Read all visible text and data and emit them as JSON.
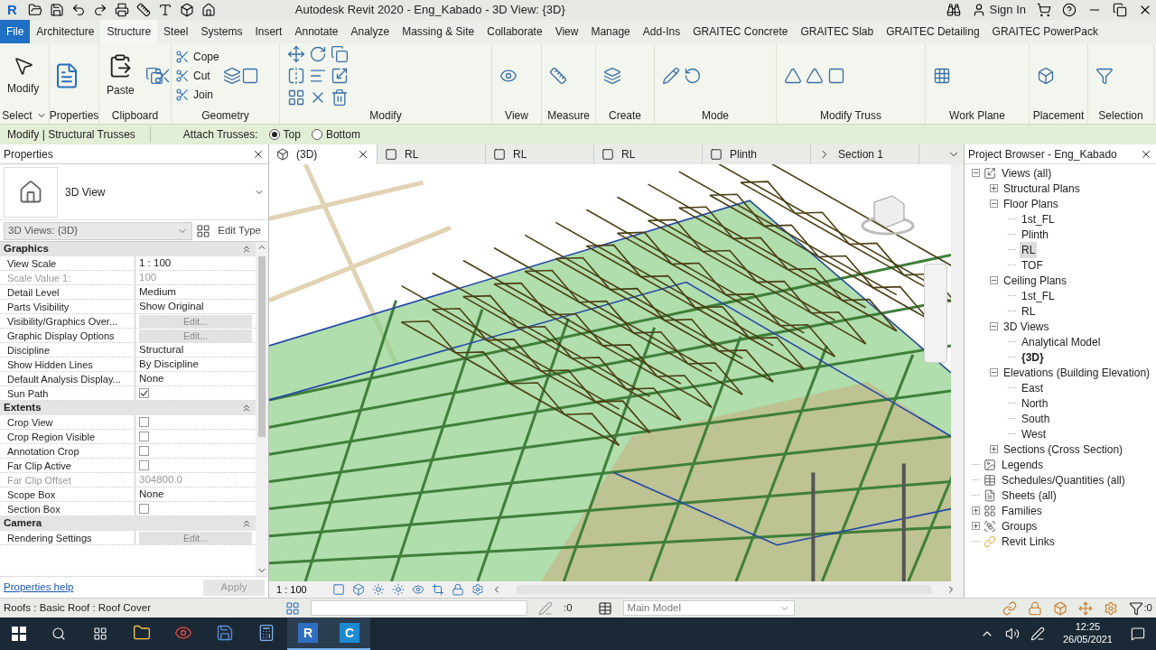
{
  "title_bar": {
    "logo": "R",
    "title": "Autodesk Revit 2020 - Eng_Kabado - 3D View: {3D}",
    "sign_in": "Sign In"
  },
  "menu_tabs": [
    {
      "label": "File",
      "kind": "file",
      "selected": false
    },
    {
      "label": "Architecture",
      "kind": "tab",
      "selected": false
    },
    {
      "label": "Structure",
      "kind": "tab",
      "selected": true
    },
    {
      "label": "Steel",
      "kind": "tab",
      "selected": false
    },
    {
      "label": "Systems",
      "kind": "tab",
      "selected": false
    },
    {
      "label": "Insert",
      "kind": "tab",
      "selected": false
    },
    {
      "label": "Annotate",
      "kind": "tab",
      "selected": false
    },
    {
      "label": "Analyze",
      "kind": "tab",
      "selected": false
    },
    {
      "label": "Massing & Site",
      "kind": "tab",
      "selected": false
    },
    {
      "label": "Collaborate",
      "kind": "tab",
      "selected": false
    },
    {
      "label": "View",
      "kind": "tab",
      "selected": false
    },
    {
      "label": "Manage",
      "kind": "tab",
      "selected": false
    },
    {
      "label": "Add-Ins",
      "kind": "tab",
      "selected": false
    },
    {
      "label": "GRAITEC Concrete",
      "kind": "tab",
      "selected": false
    },
    {
      "label": "GRAITEC Slab",
      "kind": "tab",
      "selected": false
    },
    {
      "label": "GRAITEC Detailing",
      "kind": "tab",
      "selected": false
    },
    {
      "label": "GRAITEC PowerPack",
      "kind": "tab",
      "selected": false
    }
  ],
  "ribbon_panels": [
    {
      "label": "Select",
      "dropdown": true,
      "tools": [
        {
          "label": "Modify",
          "kind": "large"
        }
      ]
    },
    {
      "label": "Properties"
    },
    {
      "label": "Clipboard",
      "tools": [
        {
          "label": "Paste",
          "kind": "large"
        }
      ]
    },
    {
      "label": "Geometry",
      "tools": [
        {
          "label": "Cope",
          "kind": "small"
        },
        {
          "label": "Cut",
          "kind": "small"
        },
        {
          "label": "Join",
          "kind": "small"
        }
      ]
    },
    {
      "label": "Modify"
    },
    {
      "label": "View"
    },
    {
      "label": "Measure"
    },
    {
      "label": "Create"
    },
    {
      "label": "Mode"
    },
    {
      "label": "Modify Truss"
    },
    {
      "label": "Work Plane"
    },
    {
      "label": "Placement"
    },
    {
      "label": "Selection"
    }
  ],
  "options_bar": {
    "context": "Modify | Structural Trusses",
    "attach_label": "Attach Trusses:",
    "options": [
      {
        "label": "Top",
        "selected": true
      },
      {
        "label": "Bottom",
        "selected": false
      }
    ]
  },
  "properties": {
    "title": "Properties",
    "type_name": "3D View",
    "instance_selector": "3D Views: {3D}",
    "edit_type": "Edit Type",
    "groups": [
      {
        "name": "Graphics",
        "rows": [
          {
            "name": "View Scale",
            "value": "1 : 100",
            "kind": "text",
            "disabled": false
          },
          {
            "name": "Scale Value 1:",
            "value": "100",
            "kind": "text",
            "disabled": true
          },
          {
            "name": "Detail Level",
            "value": "Medium",
            "kind": "text",
            "disabled": false
          },
          {
            "name": "Parts Visibility",
            "value": "Show Original",
            "kind": "text",
            "disabled": false
          },
          {
            "name": "Visibility/Graphics Over...",
            "value": "Edit...",
            "kind": "button",
            "disabled": false
          },
          {
            "name": "Graphic Display Options",
            "value": "Edit...",
            "kind": "button",
            "disabled": false
          },
          {
            "name": "Discipline",
            "value": "Structural",
            "kind": "text",
            "disabled": false
          },
          {
            "name": "Show Hidden Lines",
            "value": "By Discipline",
            "kind": "text",
            "disabled": false
          },
          {
            "name": "Default Analysis Display...",
            "value": "None",
            "kind": "text",
            "disabled": false
          },
          {
            "name": "Sun Path",
            "kind": "check",
            "checked": true,
            "disabled": false
          }
        ]
      },
      {
        "name": "Extents",
        "rows": [
          {
            "name": "Crop View",
            "kind": "check",
            "checked": false,
            "disabled": false
          },
          {
            "name": "Crop Region Visible",
            "kind": "check",
            "checked": false,
            "disabled": false
          },
          {
            "name": "Annotation Crop",
            "kind": "check",
            "checked": false,
            "disabled": false
          },
          {
            "name": "Far Clip Active",
            "kind": "check",
            "checked": false,
            "disabled": false
          },
          {
            "name": "Far Clip Offset",
            "value": "304800.0",
            "kind": "text",
            "disabled": true
          },
          {
            "name": "Scope Box",
            "value": "None",
            "kind": "text",
            "disabled": false
          },
          {
            "name": "Section Box",
            "kind": "check",
            "checked": false,
            "disabled": false
          }
        ]
      },
      {
        "name": "Camera",
        "rows": [
          {
            "name": "Rendering Settings",
            "value": "Edit...",
            "kind": "button",
            "disabled": false
          }
        ]
      }
    ],
    "help_link": "Properties help",
    "apply": "Apply"
  },
  "view_tabs": [
    {
      "label": "(3D)",
      "kind": "model",
      "selected": true
    },
    {
      "label": "RL",
      "kind": "plan",
      "selected": false
    },
    {
      "label": "RL",
      "kind": "plan",
      "selected": false
    },
    {
      "label": "RL",
      "kind": "plan",
      "selected": false
    },
    {
      "label": "Plinth",
      "kind": "plan",
      "selected": false
    },
    {
      "label": "Section 1",
      "kind": "section",
      "selected": false
    }
  ],
  "view_control_bar": {
    "scale": "1 : 100"
  },
  "project_browser": {
    "title": "Project Browser - Eng_Kabado",
    "tree": [
      {
        "label": "Views (all)",
        "kind": "views",
        "expanded": true,
        "selected": false,
        "children": [
          {
            "label": "Structural Plans",
            "expanded": false,
            "selected": false
          },
          {
            "label": "Floor Plans",
            "expanded": true,
            "selected": false,
            "children": [
              {
                "label": "1st_FL",
                "selected": false
              },
              {
                "label": "Plinth",
                "selected": false
              },
              {
                "label": "RL",
                "selected": true
              },
              {
                "label": "TOF",
                "selected": false
              }
            ]
          },
          {
            "label": "Ceiling Plans",
            "expanded": true,
            "selected": false,
            "children": [
              {
                "label": "1st_FL",
                "selected": false
              },
              {
                "label": "RL",
                "selected": false
              }
            ]
          },
          {
            "label": "3D Views",
            "expanded": true,
            "selected": false,
            "children": [
              {
                "label": "Analytical Model",
                "selected": false,
                "current": false
              },
              {
                "label": "{3D}",
                "selected": false,
                "current": true
              }
            ]
          },
          {
            "label": "Elevations (Building Elevation)",
            "expanded": true,
            "selected": false,
            "children": [
              {
                "label": "East",
                "selected": false
              },
              {
                "label": "North",
                "selected": false
              },
              {
                "label": "South",
                "selected": false
              },
              {
                "label": "West",
                "selected": false
              }
            ]
          },
          {
            "label": "Sections (Cross Section)",
            "expanded": false,
            "selected": false
          }
        ]
      },
      {
        "label": "Legends",
        "kind": "legend",
        "selected": false
      },
      {
        "label": "Schedules/Quantities (all)",
        "kind": "schedule",
        "selected": false
      },
      {
        "label": "Sheets (all)",
        "kind": "sheet",
        "selected": false
      },
      {
        "label": "Families",
        "kind": "family",
        "expanded": false,
        "selected": false
      },
      {
        "label": "Groups",
        "kind": "group",
        "expanded": false,
        "selected": false
      },
      {
        "label": "Revit Links",
        "kind": "link",
        "selected": false
      }
    ]
  },
  "status_bar": {
    "text": "Roofs : Basic Roof : Roof Cover",
    "editable_count": ":0",
    "model": "Main Model",
    "filter_count": ":0"
  },
  "taskbar": {
    "apps": [
      {
        "kind": "explorer",
        "running": false
      },
      {
        "kind": "chrome",
        "running": false
      },
      {
        "kind": "editor",
        "running": false
      },
      {
        "kind": "calculator",
        "running": false
      },
      {
        "kind": "revit",
        "letter": "R",
        "running": true
      },
      {
        "kind": "c-app",
        "letter": "C",
        "running": true
      }
    ],
    "time": "12:25",
    "date": "26/05/2021"
  }
}
